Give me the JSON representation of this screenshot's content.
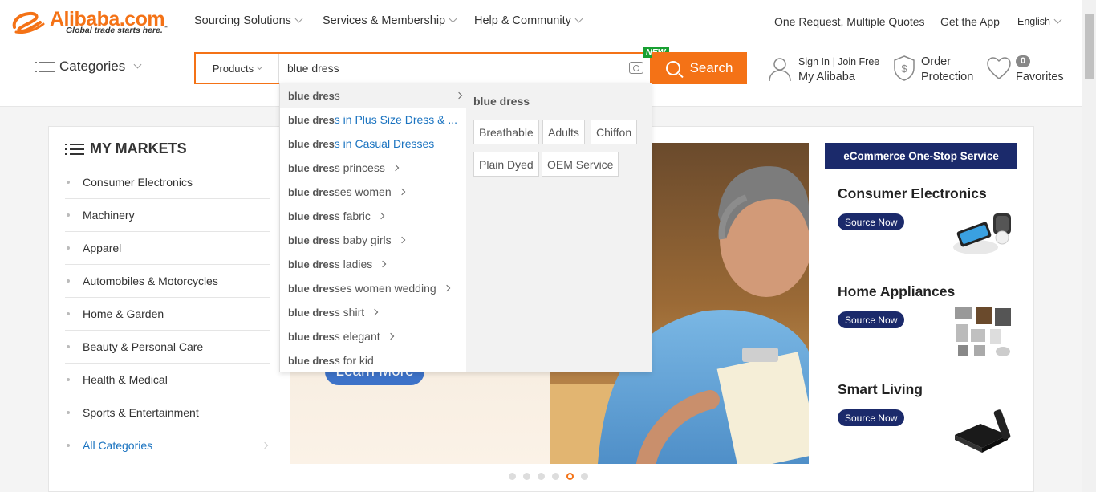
{
  "brand": {
    "name": "Alibaba.com",
    "tagline": "Global trade starts here.",
    "tm": "™"
  },
  "topnav": {
    "sourcing": "Sourcing Solutions",
    "services": "Services & Membership",
    "help": "Help & Community",
    "rfq": "One Request, Multiple Quotes",
    "app": "Get the App",
    "language": "English"
  },
  "header": {
    "categories": "Categories",
    "search_scope": "Products",
    "search_value": "blue dress",
    "new_badge": "NEW",
    "search_button": "Search",
    "sign_in": "Sign In",
    "join_free": "Join Free",
    "my_alibaba": "My Alibaba",
    "order": "Order",
    "protection": "Protection",
    "favorites_count": "0",
    "favorites": "Favorites"
  },
  "markets": {
    "title": "MY MARKETS",
    "items": [
      "Consumer Electronics",
      "Machinery",
      "Apparel",
      "Automobiles & Motorcycles",
      "Home & Garden",
      "Beauty & Personal Care",
      "Health & Medical",
      "Sports & Entertainment",
      "All Categories"
    ]
  },
  "banner": {
    "cta": "Learn More"
  },
  "ecommerce": {
    "header": "eCommerce One-Stop Service",
    "cards": [
      {
        "title": "Consumer Electronics",
        "button": "Source Now"
      },
      {
        "title": "Home Appliances",
        "button": "Source Now"
      },
      {
        "title": "Smart Living",
        "button": "Source Now"
      }
    ]
  },
  "dropdown": {
    "suggestions": [
      {
        "bold": "blue dres",
        "rest": "s",
        "link": false,
        "arrow": true
      },
      {
        "bold": "blue dres",
        "rest": "s in Plus Size Dress & ...",
        "link": true,
        "arrow": false
      },
      {
        "bold": "blue dres",
        "rest": "s in Casual Dresses",
        "link": true,
        "arrow": false
      },
      {
        "bold": "blue dres",
        "rest": "s princess",
        "link": false,
        "arrow": true
      },
      {
        "bold": "blue dres",
        "rest": "ses women",
        "link": false,
        "arrow": true
      },
      {
        "bold": "blue dres",
        "rest": "s fabric",
        "link": false,
        "arrow": true
      },
      {
        "bold": "blue dres",
        "rest": "s baby girls",
        "link": false,
        "arrow": true
      },
      {
        "bold": "blue dres",
        "rest": "s ladies",
        "link": false,
        "arrow": true
      },
      {
        "bold": "blue dres",
        "rest": "ses women wedding",
        "link": false,
        "arrow": true
      },
      {
        "bold": "blue dres",
        "rest": "s shirt",
        "link": false,
        "arrow": true
      },
      {
        "bold": "blue dres",
        "rest": "s elegant",
        "link": false,
        "arrow": true
      },
      {
        "bold": "blue dres",
        "rest": "s for kid",
        "link": false,
        "arrow": false
      }
    ],
    "attr_title": "blue dress",
    "attrs": [
      "Breathable",
      "Adults",
      "Chiffon",
      "Plain Dyed",
      "OEM Service"
    ]
  },
  "carousel": {
    "count": 6,
    "active": 5
  },
  "colors": {
    "accent": "#f47216",
    "navy": "#1b2a6b",
    "link": "#1a73c0",
    "new": "#18a032"
  }
}
